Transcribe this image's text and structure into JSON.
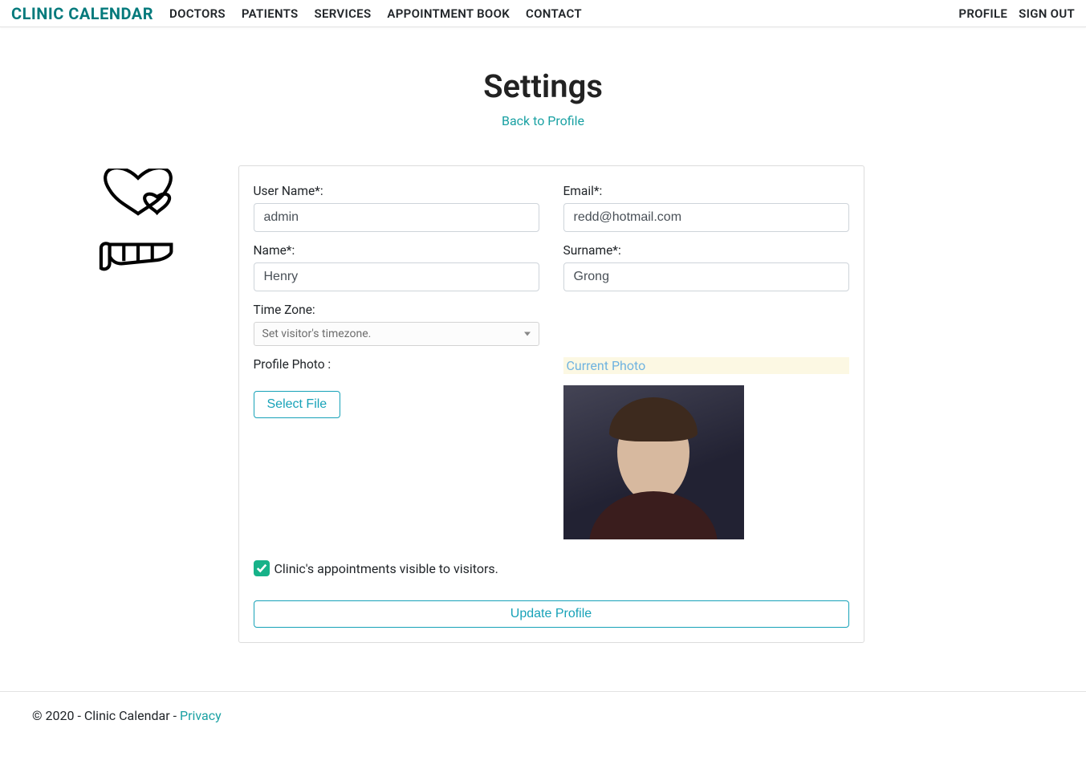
{
  "nav": {
    "brand": "CLINIC CALENDAR",
    "left": {
      "doctors": "DOCTORS",
      "patients": "PATIENTS",
      "services": "SERVICES",
      "appointment_book": "APPOINTMENT BOOK",
      "contact": "CONTACT"
    },
    "right": {
      "profile": "PROFILE",
      "sign_out": "SIGN OUT"
    }
  },
  "page": {
    "title": "Settings",
    "back_link": "Back to Profile"
  },
  "form": {
    "labels": {
      "username": "User Name*:",
      "email": "Email*:",
      "name": "Name*:",
      "surname": "Surname*:",
      "timezone": "Time Zone:",
      "profile_photo": "Profile Photo :",
      "current_photo": "Current Photo"
    },
    "values": {
      "username": "admin",
      "email": "redd@hotmail.com",
      "name": "Henry",
      "surname": "Grong",
      "timezone": "Set visitor's timezone."
    },
    "select_file": "Select File",
    "visible_checkbox_checked": true,
    "visible_checkbox_label": "Clinic's appointments visible to visitors.",
    "submit": "Update Profile"
  },
  "footer": {
    "text": "© 2020 - Clinic Calendar - ",
    "privacy": "Privacy"
  }
}
